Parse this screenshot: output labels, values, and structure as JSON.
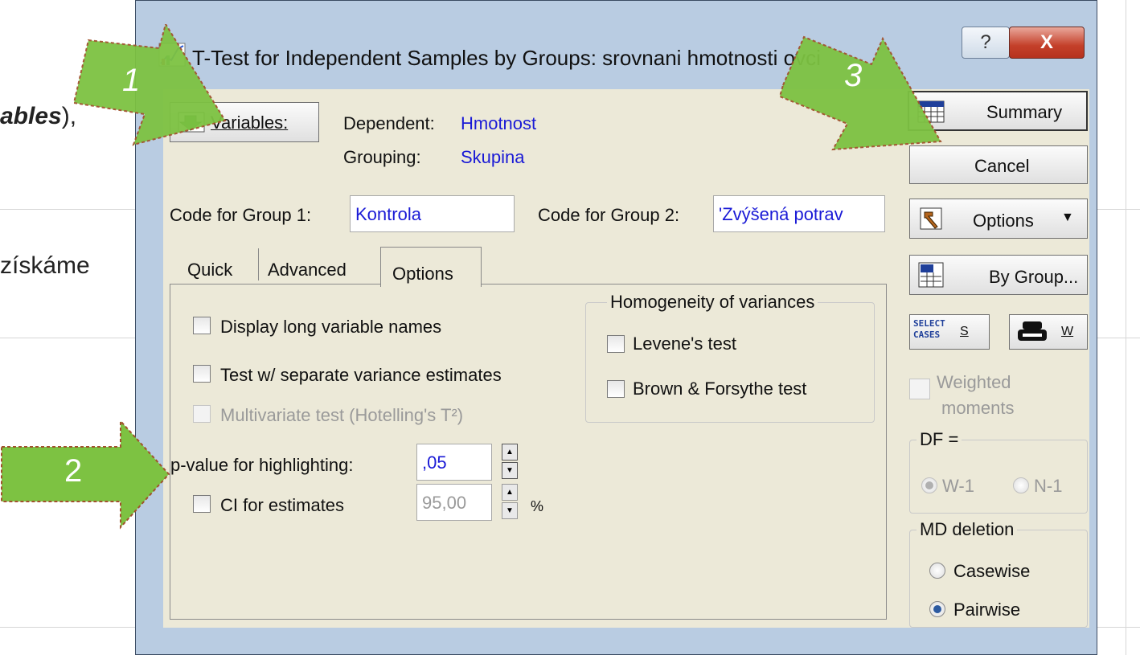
{
  "background": {
    "fragment_1": "ables",
    "fragment_1_suffix": "),",
    "fragment_2": "získáme"
  },
  "window": {
    "title": "T-Test for Independent Samples by Groups: srovnani hmotnosti ovci",
    "help_glyph": "?",
    "close_glyph": "X"
  },
  "variables": {
    "button_label": "Variables:",
    "dependent_label": "Dependent:",
    "dependent_value": "Hmotnost",
    "grouping_label": "Grouping:",
    "grouping_value": "Skupina"
  },
  "codes": {
    "group1_label": "Code for Group 1:",
    "group1_value": "Kontrola",
    "group2_label": "Code for Group 2:",
    "group2_value": "'Zvýšená potrav"
  },
  "tabs": [
    {
      "label": "Quick"
    },
    {
      "label": "Advanced"
    },
    {
      "label": "Options",
      "active": true
    }
  ],
  "options": {
    "display_long_names": "Display long variable names",
    "separate_variance": "Test w/ separate variance estimates",
    "multivariate": "Multivariate test (Hotelling's T²)",
    "pvalue_label": "p-value for highlighting:",
    "pvalue_value": ",05",
    "ci_label": "CI for estimates",
    "ci_value": "95,00",
    "ci_unit": "%"
  },
  "homogeneity": {
    "legend": "Homogeneity of variances",
    "levene": "Levene's test",
    "brown_forsythe": "Brown & Forsythe test"
  },
  "side": {
    "summary": "Summary",
    "cancel": "Cancel",
    "options": "Options",
    "by_group": "By Group...",
    "select_cases_icon_text": "SELECT CASES",
    "select_cases_key": "S",
    "weight_key": "W",
    "weighted_moments_1": "Weighted",
    "weighted_moments_2": "moments",
    "df_legend": "DF =",
    "df_w1": "W-1",
    "df_n1": "N-1",
    "md_legend": "MD deletion",
    "casewise": "Casewise",
    "pairwise": "Pairwise"
  },
  "annotations": {
    "arrow_1": "1",
    "arrow_2": "2",
    "arrow_3": "3",
    "arrow_color": "#7dc242"
  }
}
